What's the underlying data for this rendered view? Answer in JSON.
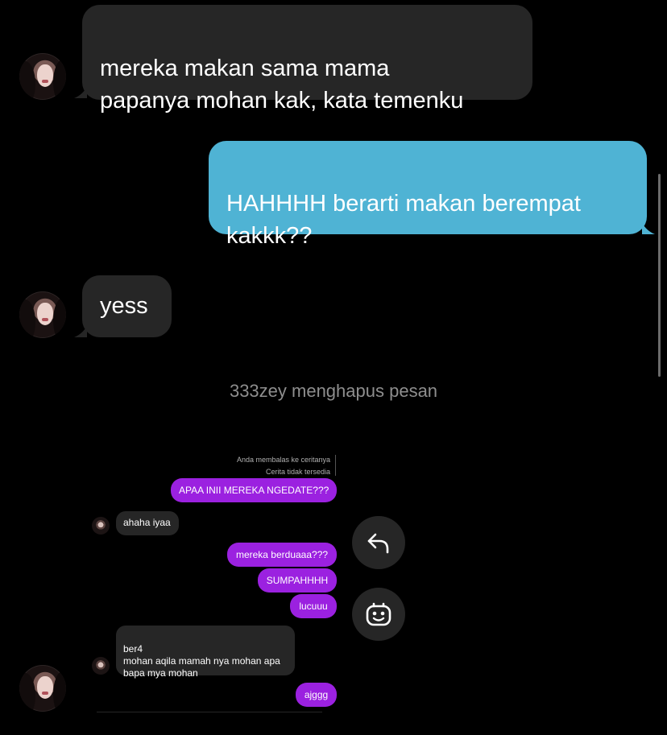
{
  "messages": {
    "m1": "mereka makan sama mama\npapanya mohan kak, kata temenku",
    "m2": "HAHHHH berarti makan berempat\nkakkk??",
    "m3": "yess",
    "system": "333zey menghapus pesan"
  },
  "screenshot": {
    "reply_meta": "Anda membalas ke ceritanya",
    "reply_unavailable": "Cerita tidak tersedia",
    "out1": "APAA INII MEREKA NGEDATE???",
    "in1": "ahaha iyaa",
    "out2": "mereka berduaaa???",
    "out3": "SUMPAHHHH",
    "out4": "lucuuu",
    "in2": "ber4\nmohan aqila mamah nya mohan apa\nbapa mya mohan",
    "out5": "ajggg"
  },
  "actions": {
    "reply_icon": "reply-arrow-icon",
    "react_icon": "emoji-react-icon"
  },
  "colors": {
    "incoming_bubble": "#262626",
    "outgoing_bubble": "#4fb3d4",
    "screenshot_outgoing": "#9b21e0",
    "background": "#000000",
    "system_text": "#8e8e8e"
  }
}
